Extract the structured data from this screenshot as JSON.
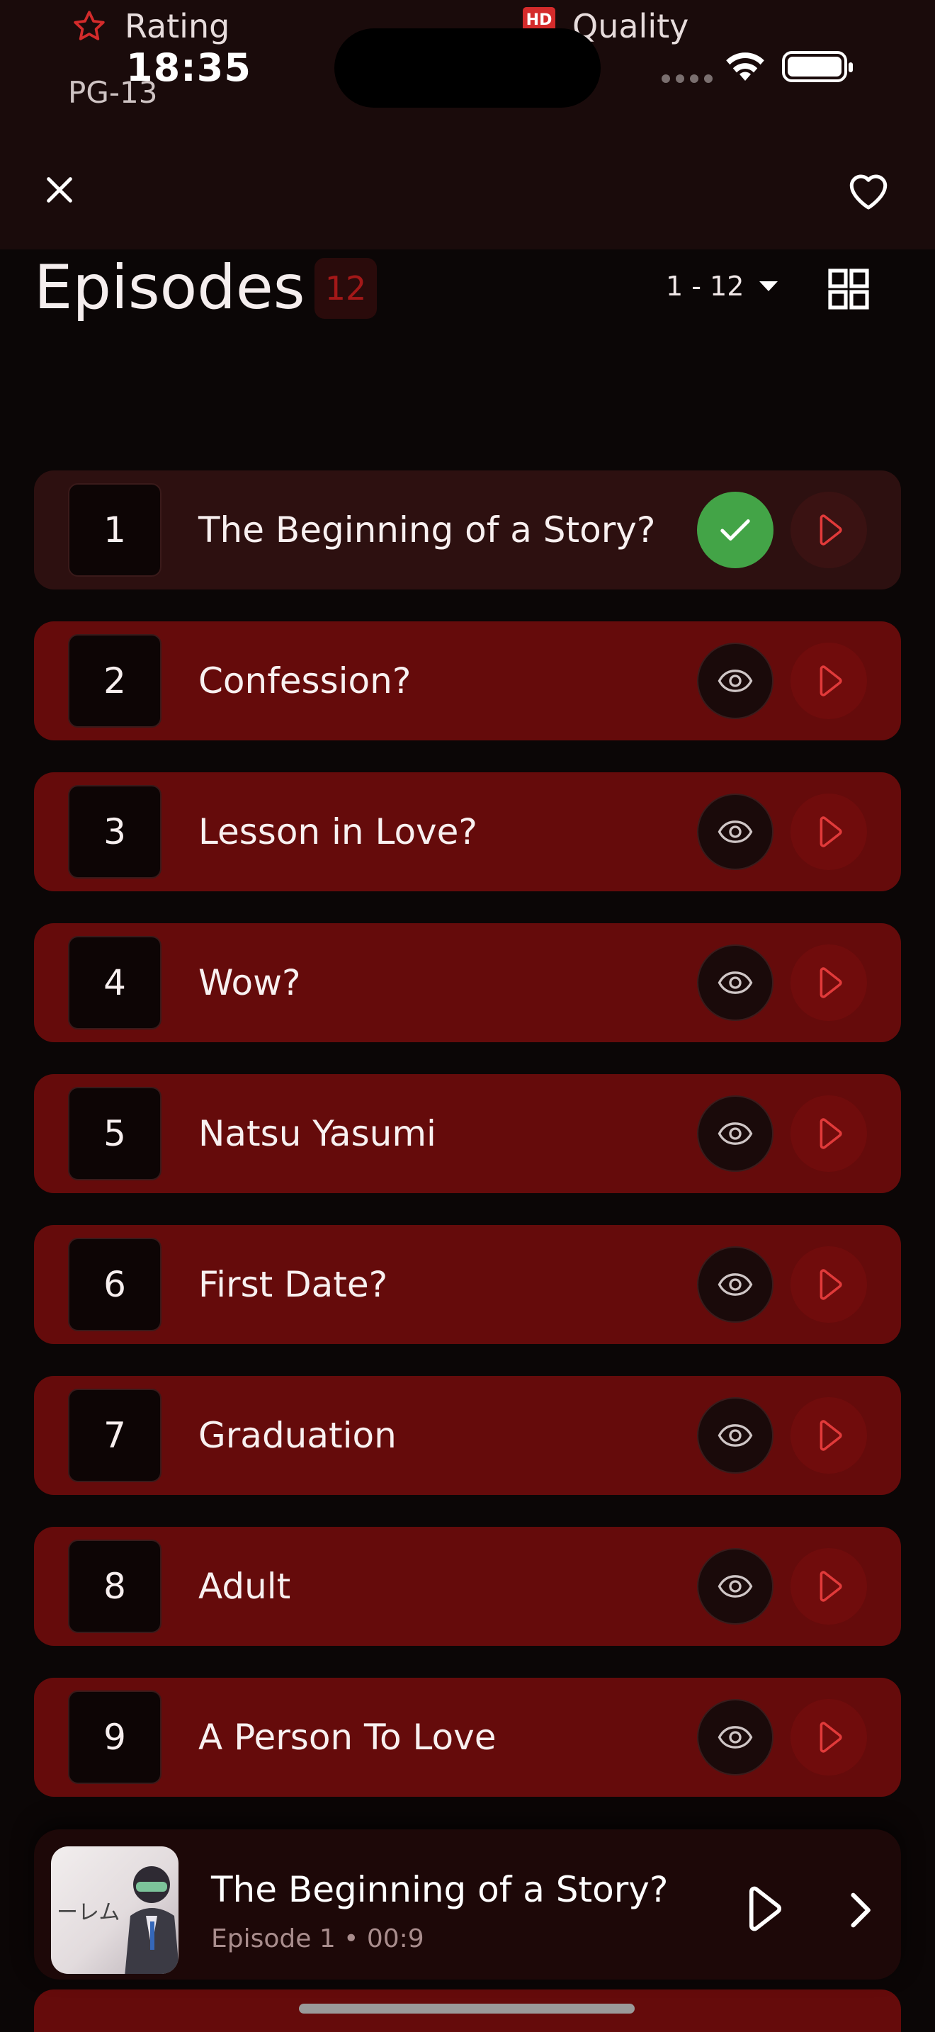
{
  "meta": {
    "rating_label": "Rating",
    "quality_label": "Quality",
    "quality_badge": "HD",
    "age_rating": "PG-13"
  },
  "status_bar": {
    "time": "18:35"
  },
  "header": {
    "close_icon": "close-icon",
    "favorite_icon": "heart-icon"
  },
  "episodes": {
    "title": "Episodes",
    "count": "12",
    "range": "1 - 12",
    "items": [
      {
        "number": "1",
        "title": "The Beginning of a Story?",
        "watched": true
      },
      {
        "number": "2",
        "title": "Confession?",
        "watched": false
      },
      {
        "number": "3",
        "title": "Lesson in Love?",
        "watched": false
      },
      {
        "number": "4",
        "title": "Wow?",
        "watched": false
      },
      {
        "number": "5",
        "title": "Natsu Yasumi",
        "watched": false
      },
      {
        "number": "6",
        "title": "First Date?",
        "watched": false
      },
      {
        "number": "7",
        "title": "Graduation",
        "watched": false
      },
      {
        "number": "8",
        "title": "Adult",
        "watched": false
      },
      {
        "number": "9",
        "title": "A Person To Love",
        "watched": false
      }
    ]
  },
  "now_playing": {
    "title": "The Beginning of a Story?",
    "subtitle": "Episode 1 • 00:9",
    "thumb_text": "ーレム"
  },
  "colors": {
    "accent_red": "#d42b2b",
    "row_red": "#650b0b",
    "watched_green": "#43a447"
  }
}
